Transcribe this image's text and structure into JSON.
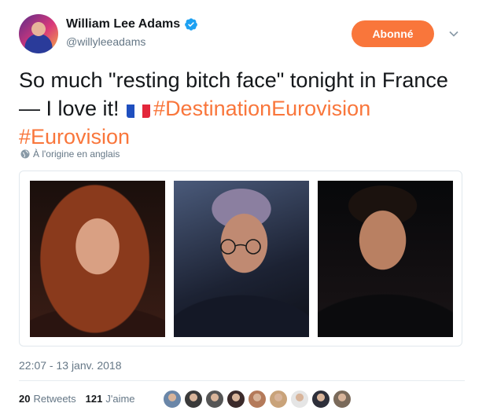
{
  "author": {
    "display_name": "William Lee Adams",
    "handle": "@willyleeadams",
    "verified": true
  },
  "follow_button": {
    "label": "Abonné"
  },
  "tweet": {
    "text_part1": "So much \"resting bitch face\" tonight in France — I love it! ",
    "flag_emoji": "french-flag",
    "hashtag1": "#DestinationEurovision",
    "hashtag2": "#Eurovision"
  },
  "translation": {
    "label": "À l'origine en anglais"
  },
  "media": {
    "photo_count": 3
  },
  "timestamp": "22:07 - 13 janv. 2018",
  "stats": {
    "retweets_count": "20",
    "retweets_label": "Retweets",
    "likes_count": "121",
    "likes_label": "J'aime"
  },
  "likers": {
    "colors": [
      "#6a86a8",
      "#3a3a3a",
      "#555555",
      "#3b2a2a",
      "#b47a5a",
      "#c9a37a",
      "#e5e5e5",
      "#2d2f3a",
      "#7a6a5a"
    ]
  },
  "colors": {
    "accent": "#f9763b",
    "verified": "#1da1f2",
    "muted": "#657786"
  }
}
